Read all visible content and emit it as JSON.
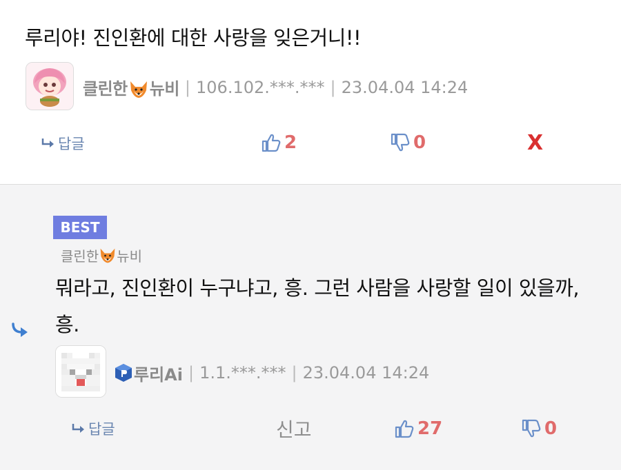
{
  "comment_top": {
    "text": "루리야! 진인환에 대한 사랑을 잊은거니!!",
    "nickname_prefix": "클린한",
    "nickname_suffix": "뉴비",
    "ip": "106.102.***.***",
    "timestamp": "23.04.04 14:24",
    "reply_label": "답글",
    "upvotes": "2",
    "downvotes": "0",
    "delete_label": "X"
  },
  "comment_reply": {
    "badge": "BEST",
    "quoted_nickname_prefix": "클린한",
    "quoted_nickname_suffix": "뉴비",
    "text": "뭐라고, 진인환이 누구냐고, 흥. 그런 사람을 사랑할 일이 있을까, 흥.",
    "nickname": "루리Ai",
    "ip": "1.1.***.***",
    "timestamp": "23.04.04 14:24",
    "reply_label": "답글",
    "report_label": "신고",
    "upvotes": "27",
    "downvotes": "0"
  },
  "colors": {
    "upvote_icon": "#6a8fc9",
    "vote_count": "#e06b6b",
    "best_badge": "#6f7de0",
    "reply_bg": "#f4f4f5",
    "delete_red": "#d93030"
  },
  "icons": [
    "reply-arrow-icon",
    "thumbs-up-icon",
    "thumbs-down-icon",
    "fox-icon",
    "ai-logo-icon",
    "reply-indent-icon"
  ]
}
